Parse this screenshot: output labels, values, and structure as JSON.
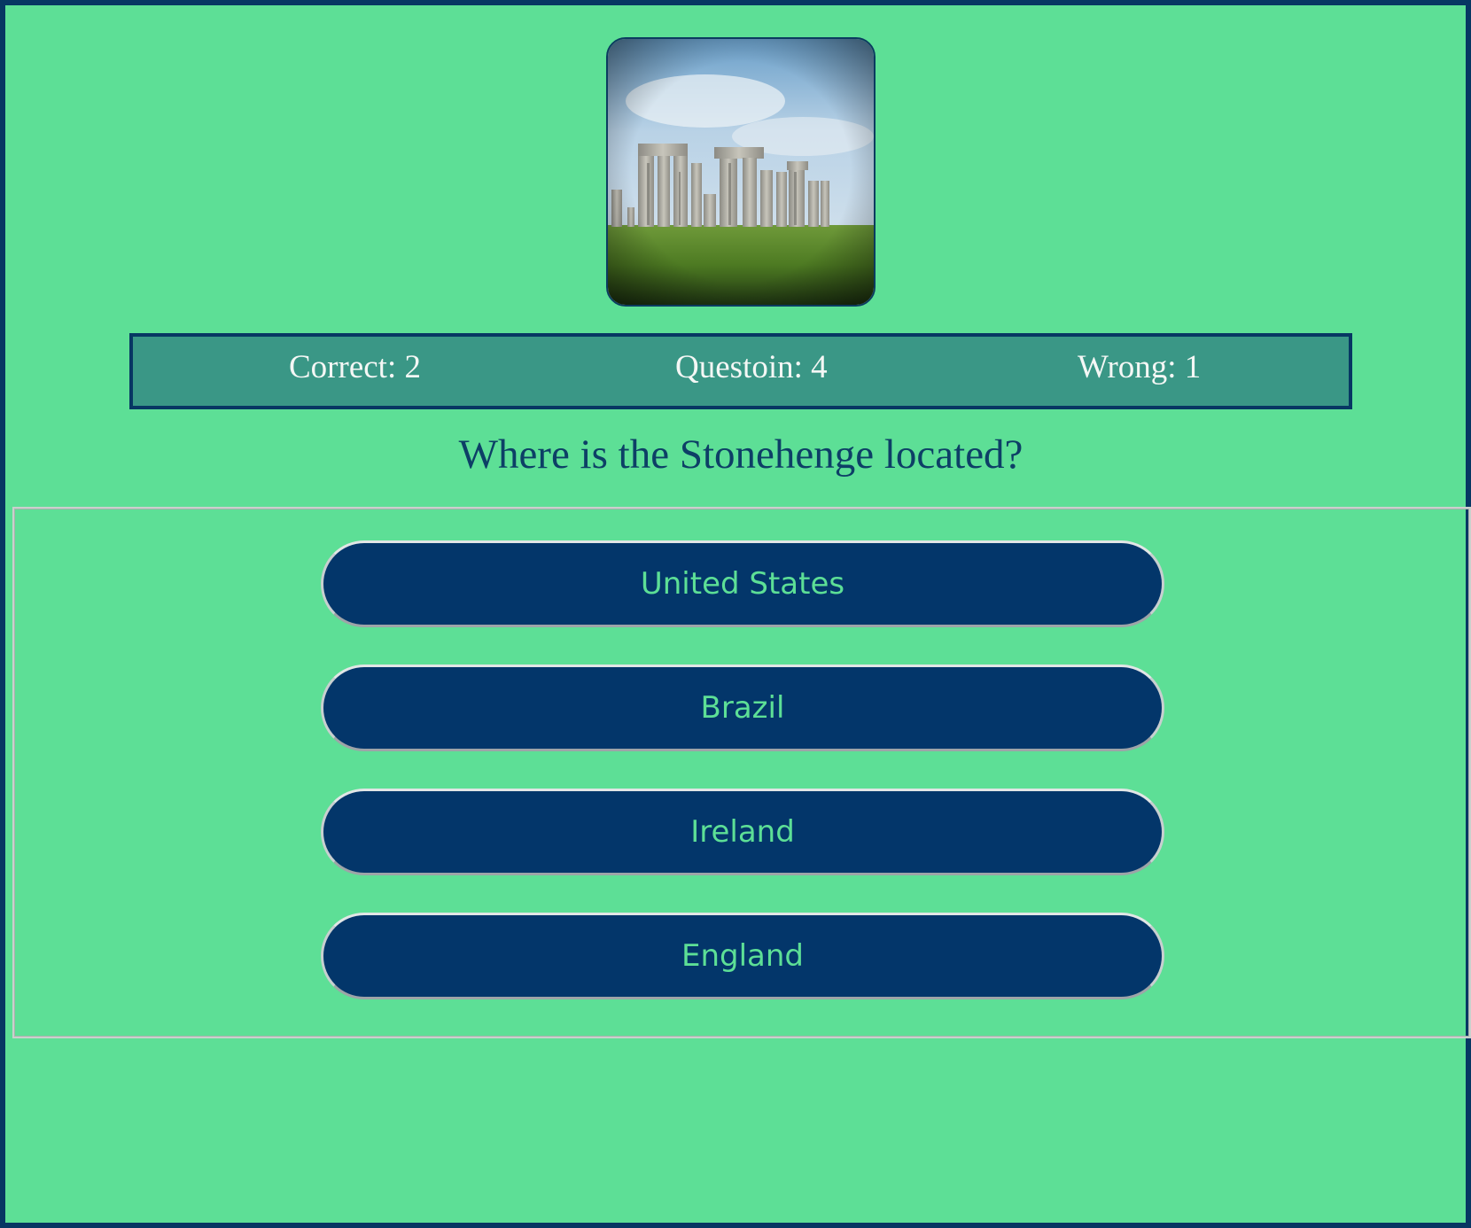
{
  "quiz": {
    "score": {
      "correct": "Correct: 2",
      "question": "Questoin: 4",
      "wrong": "Wrong: 1"
    },
    "question": "Where is the Stonehenge located?",
    "answers": [
      {
        "label": "United States"
      },
      {
        "label": "Brazil"
      },
      {
        "label": "Ireland"
      },
      {
        "label": "England"
      }
    ]
  },
  "colors": {
    "background": "#5ddf96",
    "frame_border": "#073763",
    "score_bar": "#3a9786",
    "button": "#03366a",
    "button_text": "#5ddf96",
    "question_text": "#0d3f66"
  }
}
